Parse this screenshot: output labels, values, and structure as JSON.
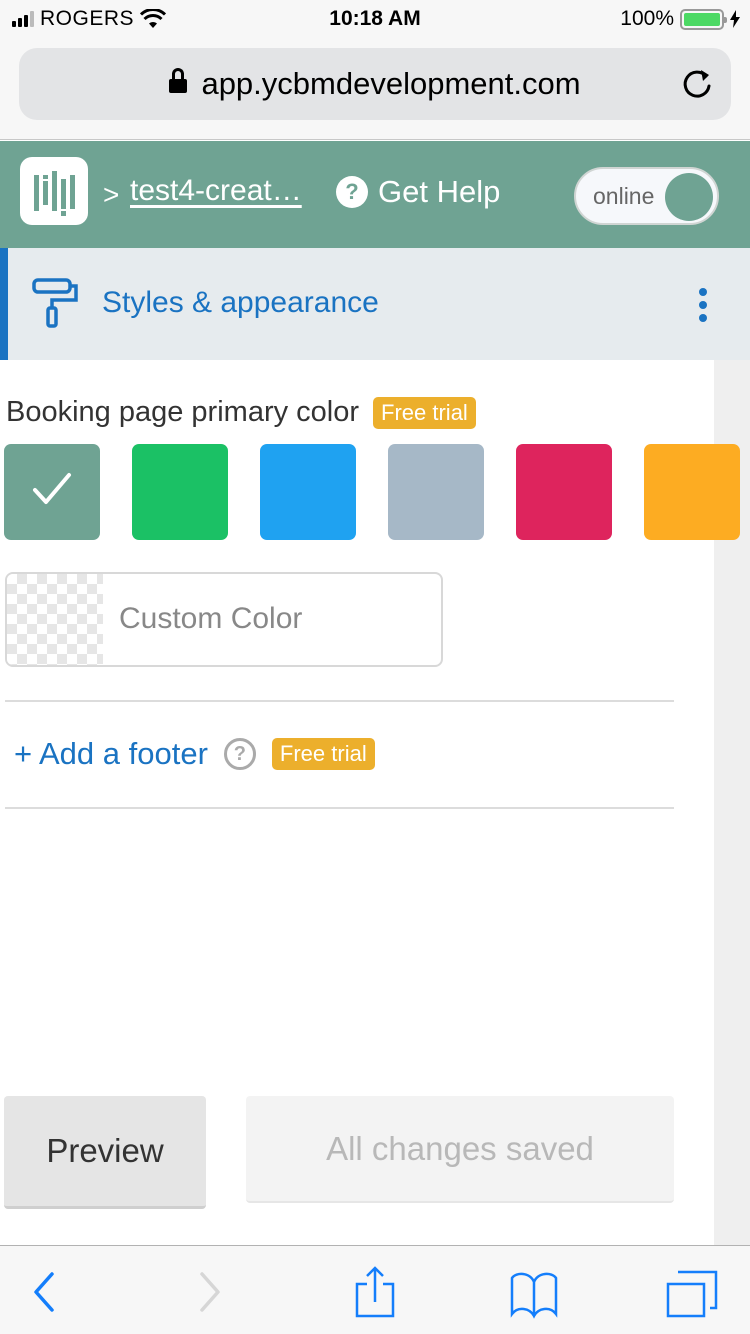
{
  "status_bar": {
    "carrier": "ROGERS",
    "time": "10:18 AM",
    "battery": "100%"
  },
  "browser": {
    "url": "app.ycbmdevelopment.com"
  },
  "header": {
    "breadcrumb_separator": ">",
    "breadcrumb_link": "test4-creat…",
    "help_label": "Get Help",
    "help_icon_glyph": "?",
    "status_toggle_label": "online"
  },
  "section": {
    "title": "Styles & appearance"
  },
  "primary_color": {
    "label": "Booking page primary color",
    "badge": "Free trial",
    "swatches": [
      {
        "name": "sage",
        "color": "#6fa393",
        "selected": true
      },
      {
        "name": "green",
        "color": "#1bc165",
        "selected": false
      },
      {
        "name": "blue",
        "color": "#1fa2f1",
        "selected": false
      },
      {
        "name": "slate",
        "color": "#a6b8c7",
        "selected": false
      },
      {
        "name": "crimson",
        "color": "#de245d",
        "selected": false
      },
      {
        "name": "amber",
        "color": "#fdac22",
        "selected": false
      }
    ],
    "custom_placeholder": "Custom Color"
  },
  "footer_option": {
    "label": "+ Add a footer",
    "help_glyph": "?",
    "badge": "Free trial"
  },
  "actions": {
    "preview_label": "Preview",
    "save_status_label": "All changes saved"
  },
  "colors": {
    "header_bg": "#6fa393",
    "accent_blue": "#1a73c2",
    "badge_bg": "#ecaf2c",
    "ios_blue": "#147efb"
  }
}
